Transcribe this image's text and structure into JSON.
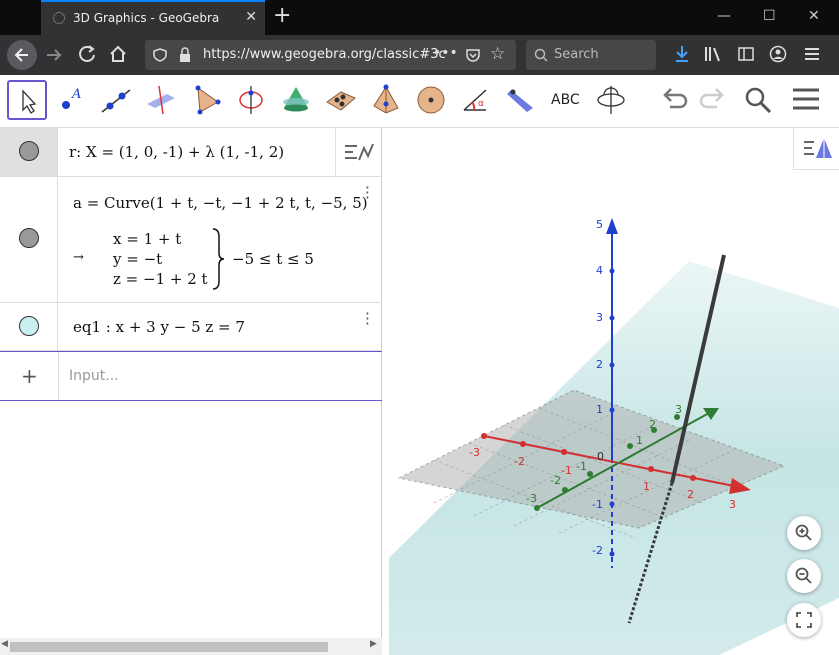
{
  "browser": {
    "tab_title": "3D Graphics - GeoGebra",
    "url": "https://www.geogebra.org/classic#3c",
    "search_placeholder": "Search"
  },
  "toolbar": {
    "text_tool_label": "ABC"
  },
  "algebra": {
    "row1": {
      "text": "r: X = (1, 0, -1) + λ (1, -1, 2)",
      "color": "#999999"
    },
    "row2": {
      "definition": "a = Curve(1 + t, −t, −1 + 2 t, t, −5, 5)",
      "arrow": "→",
      "x": "x = 1 + t",
      "y": "y = −t",
      "z": "z = −1 + 2 t",
      "range": "−5 ≤ t ≤ 5",
      "color": "#999999"
    },
    "row3": {
      "text": "eq1 : x + 3 y − 5 z = 7",
      "color": "#c8f0f0"
    },
    "input_placeholder": "Input..."
  },
  "graphics": {
    "z_ticks": [
      "5",
      "4",
      "3",
      "2",
      "1",
      "-1",
      "-2"
    ],
    "x_ticks": [
      "-3",
      "-2",
      "-1",
      "1",
      "2",
      "3"
    ],
    "y_ticks": [
      "-3",
      "-2",
      "-1",
      "1",
      "2",
      "3"
    ],
    "origin_label": "0",
    "colors": {
      "x_axis": "#d32f2f",
      "y_axis": "#2e7d32",
      "z_axis": "#1e3fcf",
      "plane": "#7fc4c4",
      "xy_plane": "#b4b4b4",
      "accent": "#6557d2"
    }
  }
}
